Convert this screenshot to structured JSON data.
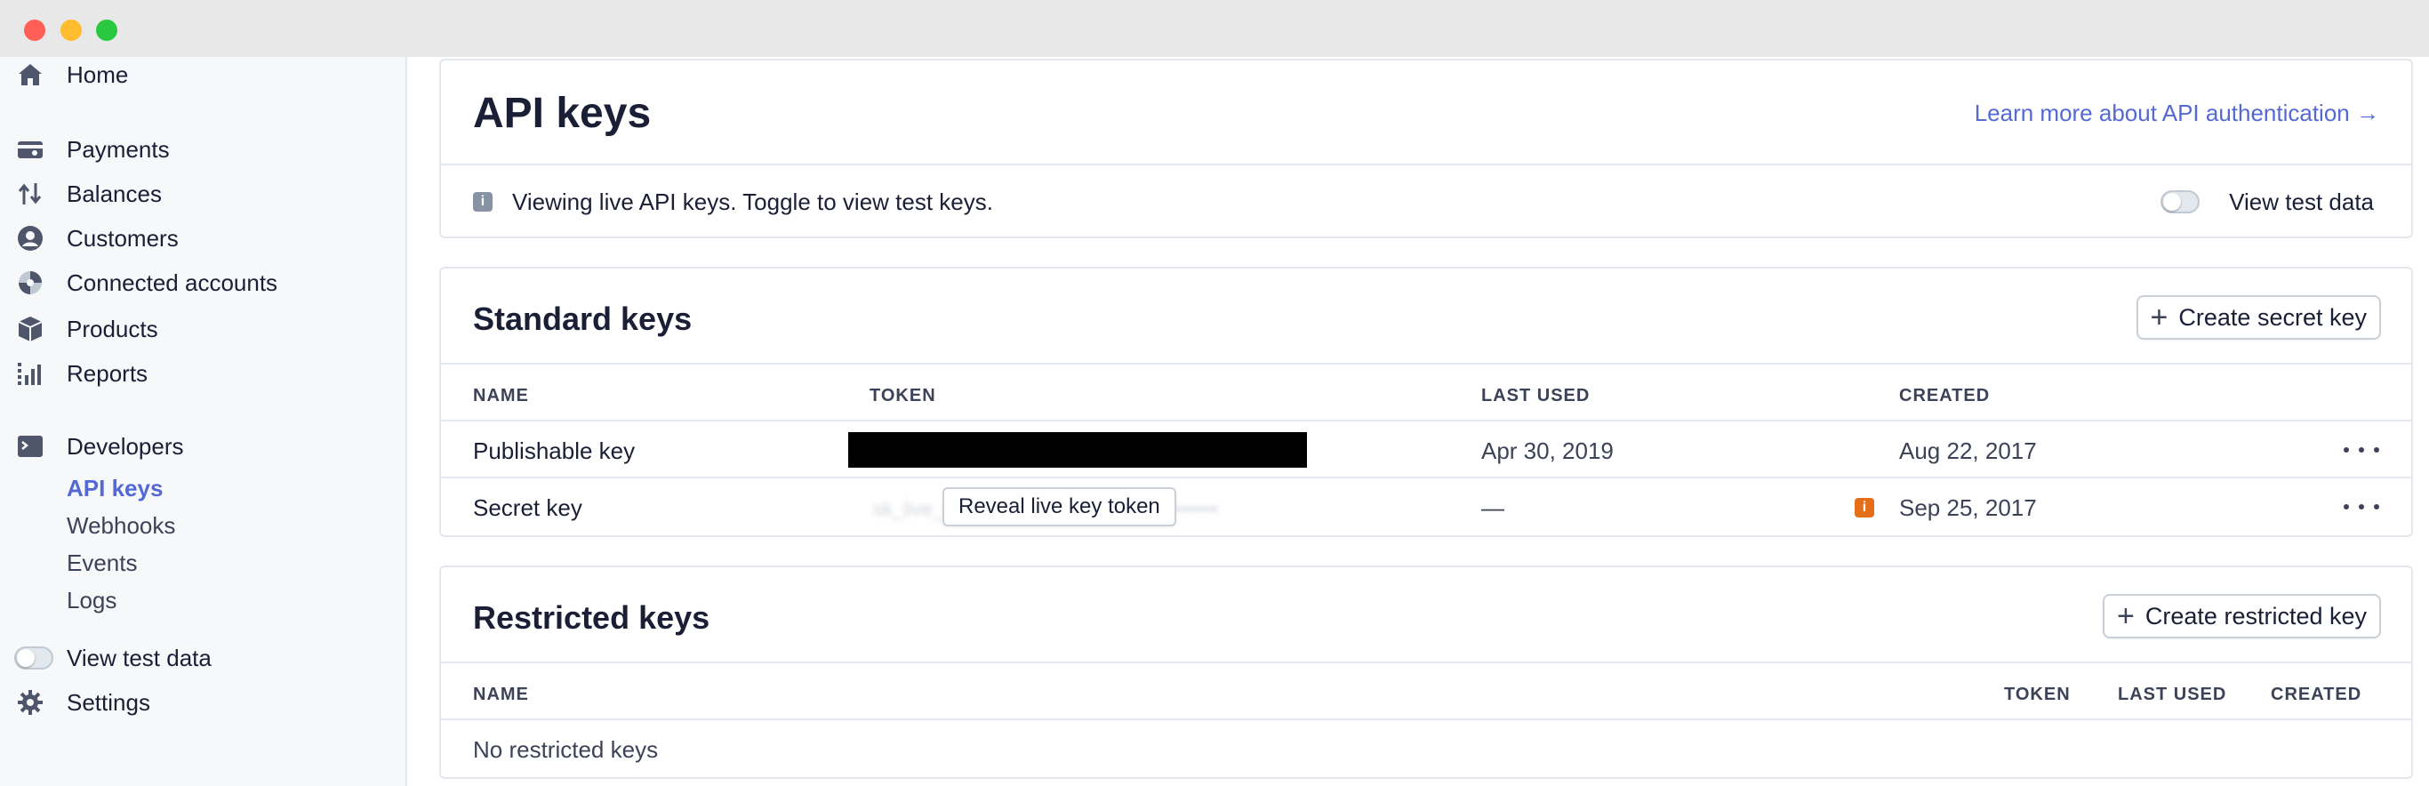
{
  "sidebar": {
    "items": [
      {
        "label": "Home",
        "icon": "home-icon"
      },
      {
        "label": "Payments",
        "icon": "payments-icon"
      },
      {
        "label": "Balances",
        "icon": "balances-icon"
      },
      {
        "label": "Customers",
        "icon": "customers-icon"
      },
      {
        "label": "Connected accounts",
        "icon": "connected-accounts-icon"
      },
      {
        "label": "Products",
        "icon": "products-icon"
      },
      {
        "label": "Reports",
        "icon": "reports-icon"
      },
      {
        "label": "Developers",
        "icon": "terminal-icon"
      }
    ],
    "developer_sub": [
      "API keys",
      "Webhooks",
      "Events",
      "Logs"
    ],
    "active_sub": "API keys",
    "view_test_data": "View test data",
    "settings": "Settings"
  },
  "header": {
    "title": "API keys",
    "learn_more": "Learn more about API authentication",
    "learn_more_arrow": "→"
  },
  "notice": {
    "text": "Viewing live API keys. Toggle to view test keys.",
    "toggle_label": "View test data",
    "toggle_on": false
  },
  "standard": {
    "title": "Standard keys",
    "create_button": "Create secret key",
    "columns": [
      "NAME",
      "TOKEN",
      "LAST USED",
      "CREATED"
    ],
    "rows": [
      {
        "name": "Publishable key",
        "last_used": "Apr 30, 2019",
        "created": "Aug 22, 2017"
      },
      {
        "name": "Secret key",
        "token_blurred": "sk_live_••••••••••••••••••••••••••••••••••••••••",
        "reveal": "Reveal live key token",
        "last_used": "—",
        "created": "Sep 25, 2017"
      }
    ]
  },
  "restricted": {
    "title": "Restricted keys",
    "create_button": "Create restricted key",
    "columns": [
      "NAME",
      "TOKEN",
      "LAST USED",
      "CREATED"
    ],
    "empty": "No restricted keys"
  },
  "colors": {
    "accent": "#5469d4",
    "warning": "#e56f18",
    "sidebar_bg": "#f6f8fa",
    "border": "#e3e8ee"
  }
}
